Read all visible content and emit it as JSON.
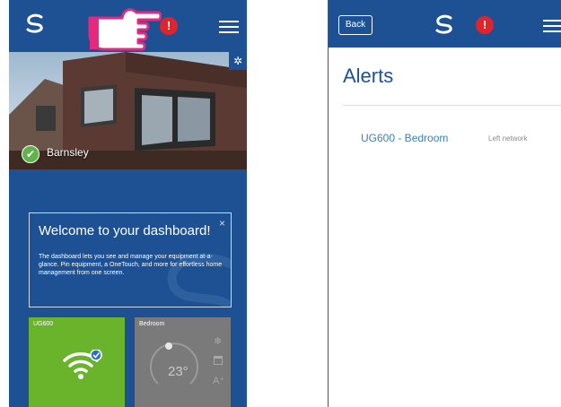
{
  "left_screen": {
    "location": {
      "name": "Barnsley"
    },
    "alert_badge": "!",
    "welcome": {
      "title": "Welcome to your dashboard!",
      "close": "×",
      "body": "The dashboard lets you see and manage your equipment at-a-glance. Pin equipment, a OneTouch, and more for effortless home management from one screen."
    },
    "tiles": [
      {
        "label": "UG600",
        "icon": "wifi-icon",
        "color": "#6ab42c"
      },
      {
        "label": "Bedroom",
        "temperature": "23°",
        "color": "#7a7a7a"
      }
    ]
  },
  "right_screen": {
    "back_label": "Back",
    "alert_badge": "!",
    "title": "Alerts",
    "alerts": [
      {
        "device": "UG600 - Bedroom",
        "status": "Left network"
      }
    ]
  },
  "colors": {
    "brand_blue": "#1d5193",
    "alert_red": "#e0242b",
    "ok_green": "#6ab42c",
    "link_blue": "#3a7fc0",
    "pointer_magenta": "#e6287e"
  }
}
